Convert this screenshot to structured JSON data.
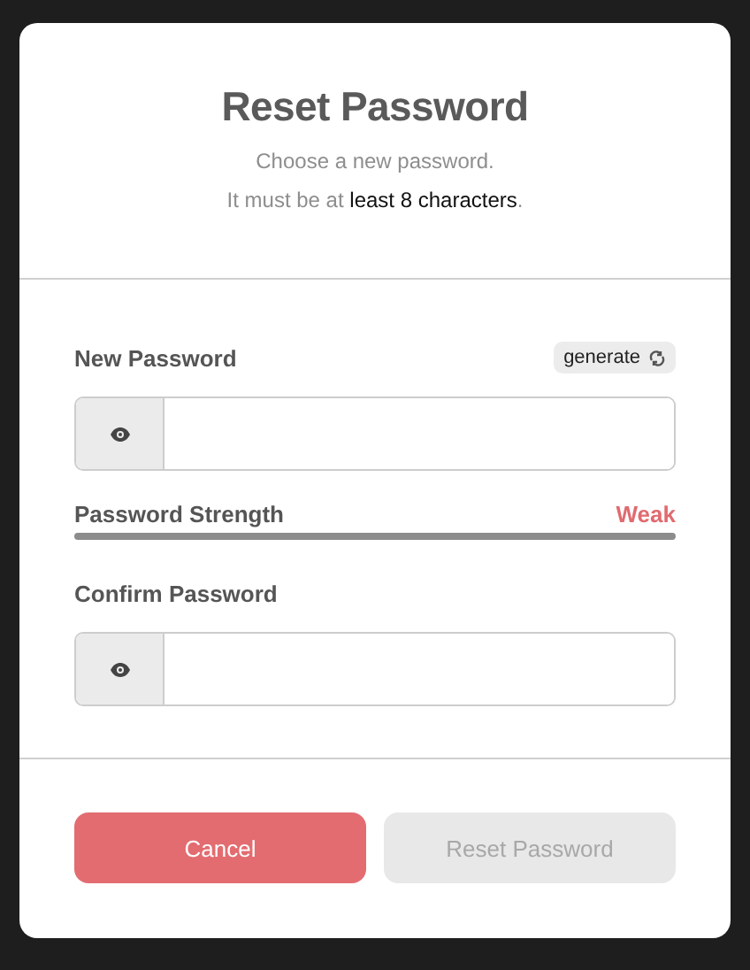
{
  "dialog": {
    "title": "Reset Password",
    "subtitle": "Choose a new password.",
    "requirement": "It must be at **least 8 characters**."
  },
  "fields": [
    {
      "label": "New Password",
      "generate": "generate"
    },
    {
      "label": "Confirm Password"
    }
  ],
  "strength": {
    "label": "Password Strength",
    "rating": "Weak"
  },
  "buttons": [
    {
      "label": "Cancel",
      "disabled": false
    },
    {
      "label": "Reset Password",
      "disabled": true
    }
  ]
}
